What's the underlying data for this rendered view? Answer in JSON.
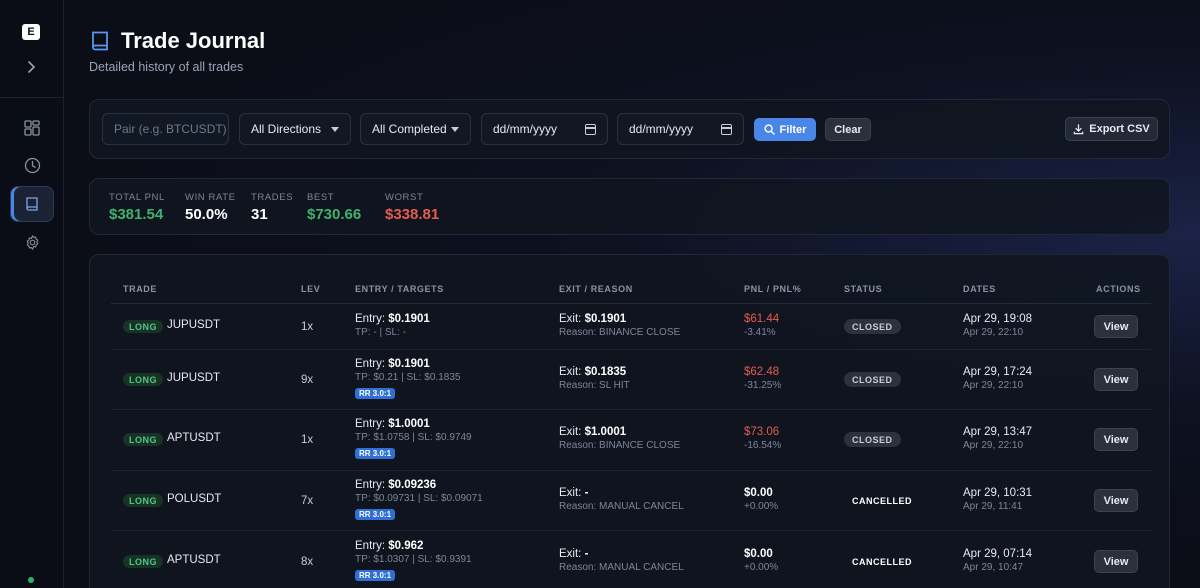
{
  "app": {
    "logo_letter": "E"
  },
  "header": {
    "title": "Trade Journal",
    "subtitle": "Detailed history of all trades"
  },
  "filters": {
    "pair_placeholder": "Pair (e.g. BTCUSDT)",
    "direction_value": "All Directions",
    "status_value": "All Completed",
    "date_from_placeholder": "dd/mm/yyyy",
    "date_to_placeholder": "dd/mm/yyyy",
    "filter_label": "Filter",
    "clear_label": "Clear",
    "export_label": "Export CSV"
  },
  "stats": {
    "total_pnl_label": "TOTAL PNL",
    "total_pnl_value": "$381.54",
    "win_rate_label": "WIN RATE",
    "win_rate_value": "50.0%",
    "trades_label": "TRADES",
    "trades_value": "31",
    "best_label": "BEST",
    "best_value": "$730.66",
    "worst_label": "WORST",
    "worst_value": "$338.81"
  },
  "table": {
    "headers": {
      "trade": "TRADE",
      "lev": "LEV",
      "entry": "ENTRY / TARGETS",
      "exit": "EXIT / REASON",
      "pnl": "PNL / PNL%",
      "status": "STATUS",
      "dates": "DATES",
      "actions": "ACTIONS"
    },
    "rows": [
      {
        "direction": "LONG",
        "pair": "JUPUSDT",
        "lev": "1x",
        "entry_prefix": "Entry: ",
        "entry": "$0.1901",
        "targets": "TP: - | SL: -",
        "rr": "",
        "exit_prefix": "Exit: ",
        "exit": "$0.1901",
        "reason": "Reason: BINANCE CLOSE",
        "pnl": "$61.44",
        "pnl_pct": "-3.41%",
        "status": "CLOSED",
        "date_open": "Apr 29, 19:08",
        "date_close": "Apr 29, 22:10",
        "action": "View"
      },
      {
        "direction": "LONG",
        "pair": "JUPUSDT",
        "lev": "9x",
        "entry_prefix": "Entry: ",
        "entry": "$0.1901",
        "targets": "TP: $0.21 | SL: $0.1835",
        "rr": "RR 3.0:1",
        "exit_prefix": "Exit: ",
        "exit": "$0.1835",
        "reason": "Reason: SL HIT",
        "pnl": "$62.48",
        "pnl_pct": "-31.25%",
        "status": "CLOSED",
        "date_open": "Apr 29, 17:24",
        "date_close": "Apr 29, 22:10",
        "action": "View"
      },
      {
        "direction": "LONG",
        "pair": "APTUSDT",
        "lev": "1x",
        "entry_prefix": "Entry: ",
        "entry": "$1.0001",
        "targets": "TP: $1.0758 | SL: $0.9749",
        "rr": "RR 3.0:1",
        "exit_prefix": "Exit: ",
        "exit": "$1.0001",
        "reason": "Reason: BINANCE CLOSE",
        "pnl": "$73.06",
        "pnl_pct": "-16.54%",
        "status": "CLOSED",
        "date_open": "Apr 29, 13:47",
        "date_close": "Apr 29, 22:10",
        "action": "View"
      },
      {
        "direction": "LONG",
        "pair": "POLUSDT",
        "lev": "7x",
        "entry_prefix": "Entry: ",
        "entry": "$0.09236",
        "targets": "TP: $0.09731 | SL: $0.09071",
        "rr": "RR 3.0:1",
        "exit_prefix": "Exit: ",
        "exit": "-",
        "reason": "Reason: MANUAL CANCEL",
        "pnl": "$0.00",
        "pnl_pct": "+0.00%",
        "status": "CANCELLED",
        "date_open": "Apr 29, 10:31",
        "date_close": "Apr 29, 11:41",
        "action": "View"
      },
      {
        "direction": "LONG",
        "pair": "APTUSDT",
        "lev": "8x",
        "entry_prefix": "Entry: ",
        "entry": "$0.962",
        "targets": "TP: $1.0307 | SL: $0.9391",
        "rr": "RR 3.0:1",
        "exit_prefix": "Exit: ",
        "exit": "-",
        "reason": "Reason: MANUAL CANCEL",
        "pnl": "$0.00",
        "pnl_pct": "+0.00%",
        "status": "CANCELLED",
        "date_open": "Apr 29, 07:14",
        "date_close": "Apr 29, 10:47",
        "action": "View"
      }
    ]
  },
  "colors": {
    "accent": "#4a86e8",
    "profit": "#3fb26d",
    "loss": "#e45b4f",
    "background": "#0b0e17"
  },
  "icons": [
    "logo-icon",
    "chevron-right-icon",
    "dashboard-icon",
    "clock-icon",
    "book-icon",
    "gear-icon",
    "search-icon",
    "download-icon",
    "calendar-icon"
  ]
}
